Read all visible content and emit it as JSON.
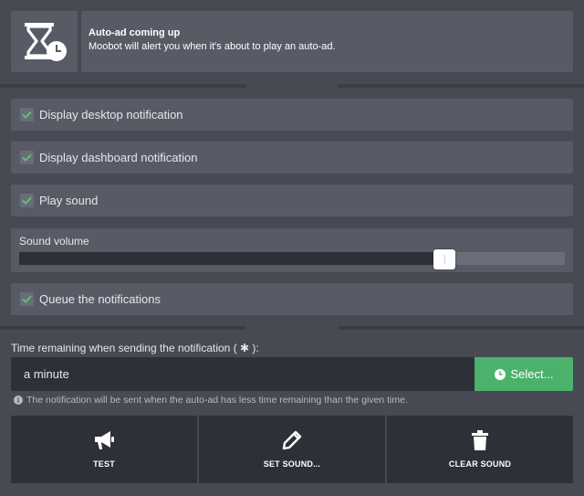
{
  "header": {
    "title": "Auto-ad coming up",
    "description": "Moobot will alert you when it's about to play an auto-ad.",
    "icon": "hourglass-clock-icon"
  },
  "options": [
    {
      "label": "Display desktop notification",
      "checked": true
    },
    {
      "label": "Display dashboard notification",
      "checked": true
    },
    {
      "label": "Play sound",
      "checked": true
    },
    {
      "label": "Queue the notifications",
      "checked": true
    }
  ],
  "volume": {
    "label": "Sound volume",
    "value_fraction": 0.78
  },
  "time": {
    "label": "Time remaining when sending the notification ( ✱ ):",
    "value": "a minute",
    "select_label": "Select...",
    "hint": "The notification will be sent when the auto-ad has less time remaining than the given time."
  },
  "actions": {
    "test": "TEST",
    "set_sound": "SET SOUND...",
    "clear_sound": "CLEAR SOUND"
  },
  "colors": {
    "background": "#474a53",
    "panel": "#585b65",
    "dark": "#2e3038",
    "accent_green": "#4cb26b",
    "check_green": "#5ec07c"
  }
}
